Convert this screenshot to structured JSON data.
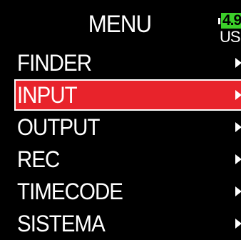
{
  "header": {
    "title": "MENU",
    "battery": {
      "level_text": "4.9",
      "power_source": "USB",
      "level_color": "#3ccf2a"
    }
  },
  "menu": {
    "accent_color": "#e8232b",
    "selected_index": 1,
    "items": [
      {
        "label": "FINDER",
        "icon": "chevron-right-icon"
      },
      {
        "label": "INPUT",
        "icon": "chevron-right-icon"
      },
      {
        "label": "OUTPUT",
        "icon": "chevron-right-icon"
      },
      {
        "label": "REC",
        "icon": "chevron-right-icon"
      },
      {
        "label": "TIMECODE",
        "icon": "chevron-right-icon"
      },
      {
        "label": "SISTEMA",
        "icon": "chevron-right-icon"
      }
    ]
  }
}
